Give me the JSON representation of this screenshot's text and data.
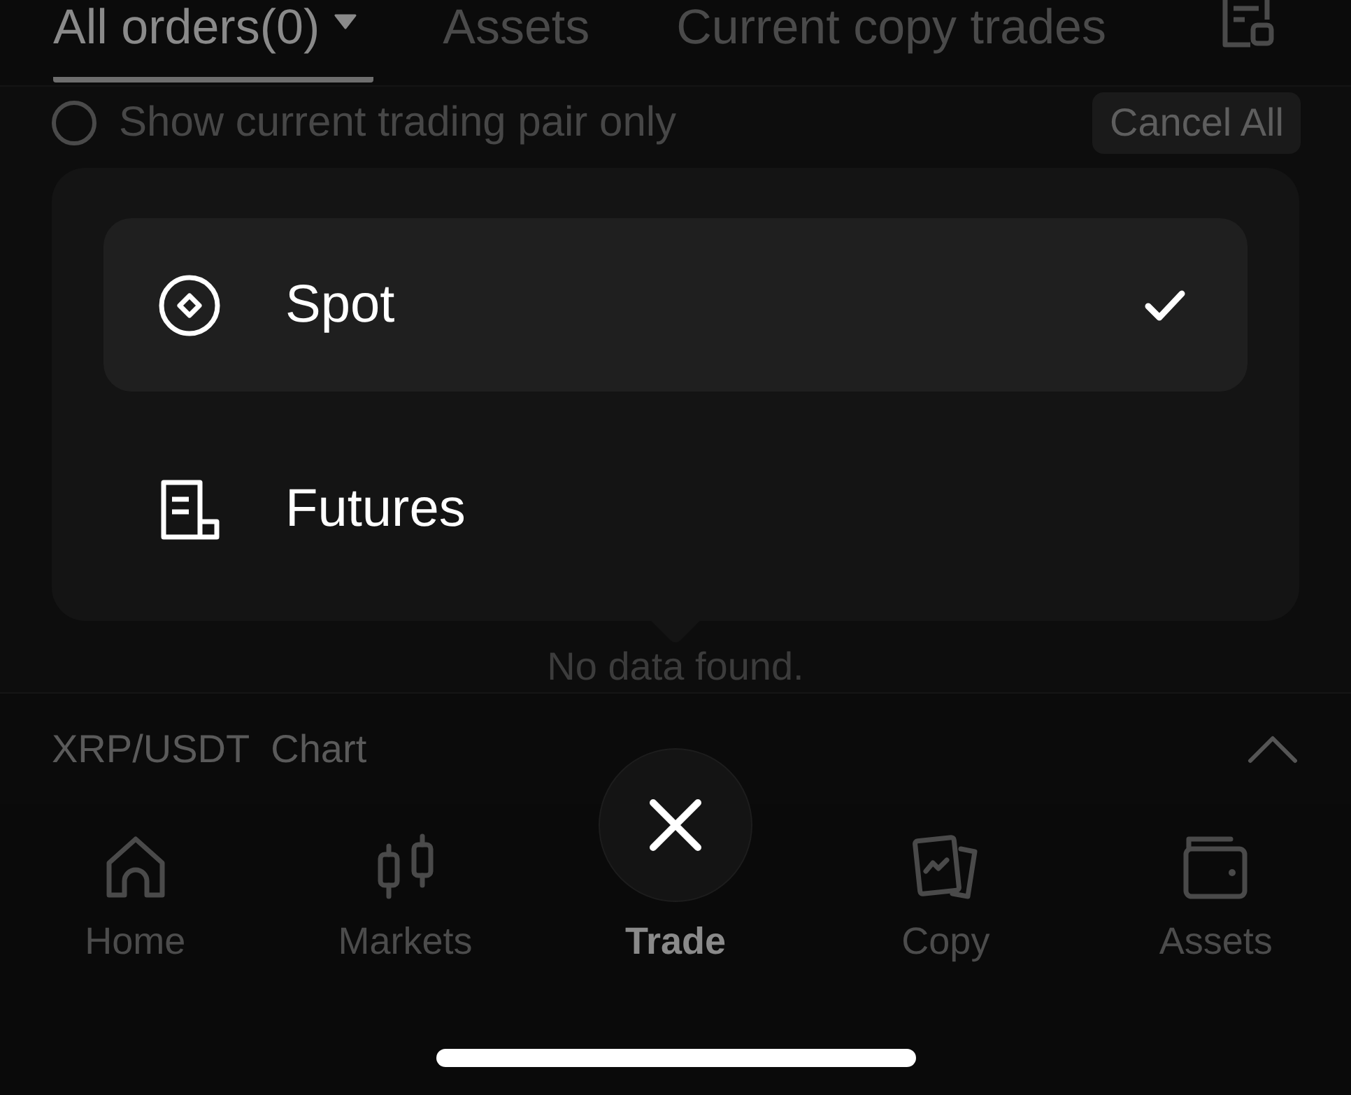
{
  "tabs": [
    {
      "label": "All orders(0)",
      "selected": true,
      "dropdown": true
    },
    {
      "label": "Assets",
      "selected": false,
      "dropdown": false
    },
    {
      "label": "Current copy trades",
      "selected": false,
      "dropdown": false
    }
  ],
  "filter": {
    "label": "Show current trading pair only",
    "checked": false
  },
  "cancel_all_button": "Cancel All",
  "empty_message": "No data found.",
  "popup_menu": {
    "items": [
      {
        "label": "Spot",
        "kind": "spot",
        "selected": true
      },
      {
        "label": "Futures",
        "kind": "futures",
        "selected": false
      }
    ]
  },
  "chart_bar": {
    "label": "XRP/USDT  Chart",
    "expanded": false
  },
  "bottom_nav": [
    {
      "label": "Home",
      "kind": "home",
      "selected": false
    },
    {
      "label": "Markets",
      "kind": "markets",
      "selected": false
    },
    {
      "label": "Trade",
      "kind": "trade",
      "selected": true
    },
    {
      "label": "Copy",
      "kind": "copy",
      "selected": false
    },
    {
      "label": "Assets",
      "kind": "assets",
      "selected": false
    }
  ]
}
